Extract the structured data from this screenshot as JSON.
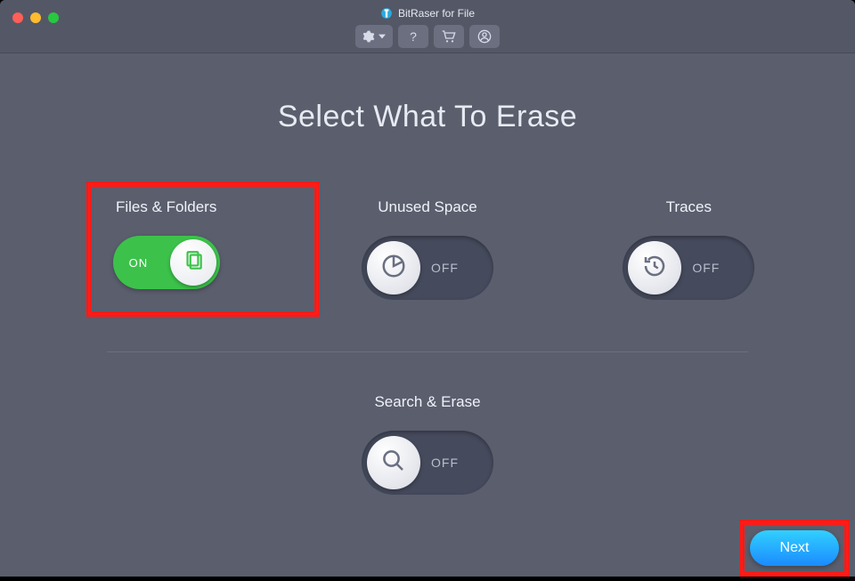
{
  "app": {
    "title": "BitRaser for File"
  },
  "page": {
    "title": "Select What To Erase"
  },
  "options": {
    "files": {
      "label": "Files & Folders",
      "state": "ON"
    },
    "unused": {
      "label": "Unused Space",
      "state": "OFF"
    },
    "traces": {
      "label": "Traces",
      "state": "OFF"
    },
    "search": {
      "label": "Search & Erase",
      "state": "OFF"
    }
  },
  "buttons": {
    "next": "Next"
  }
}
